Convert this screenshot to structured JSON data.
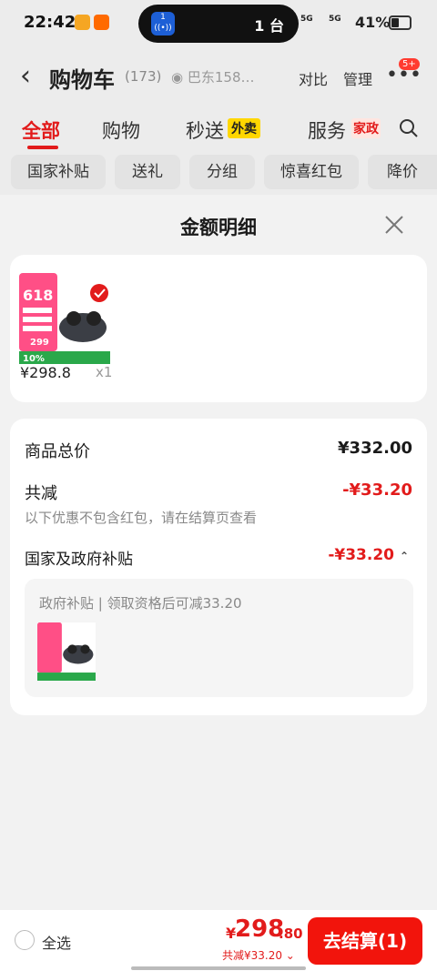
{
  "status_bar": {
    "time": "22:42",
    "island_text": "1 台",
    "signal_1": "5G",
    "signal_2": "5G",
    "battery": "41%"
  },
  "header": {
    "title": "购物车",
    "count": "(173)",
    "address": "巴东158…",
    "compare": "对比",
    "manage": "管理",
    "badge": "5+"
  },
  "tabs": [
    {
      "label": "全部"
    },
    {
      "label": "购物"
    },
    {
      "label": "秒送",
      "tag": "外卖"
    },
    {
      "label": "服务",
      "tag": "家政"
    }
  ],
  "chips": [
    "国家补贴",
    "送礼",
    "分组",
    "惊喜红包",
    "降价"
  ],
  "sheet": {
    "title": "金额明细",
    "product": {
      "price": "¥298.8",
      "qty": "x1",
      "badge_618": "618",
      "img_price": "299",
      "img_discount": "10%"
    },
    "rows": {
      "total_label": "商品总价",
      "total_value": "¥332.00",
      "reduce_label": "共减",
      "reduce_value": "-¥33.20",
      "note": "以下优惠不包含红包，请在结算页查看",
      "subsidy_label": "国家及政府补贴",
      "subsidy_value": "-¥33.20"
    },
    "inner_text": "政府补贴 | 领取资格后可减33.20"
  },
  "footer": {
    "select_all": "全选",
    "currency": "¥",
    "total_main": "298",
    "total_dec": ".80",
    "discount": "共减¥33.20 ⌄",
    "checkout": "去结算(1)"
  },
  "colors": {
    "accent": "#e21b1b",
    "checkout_bg": "#f2140c"
  }
}
